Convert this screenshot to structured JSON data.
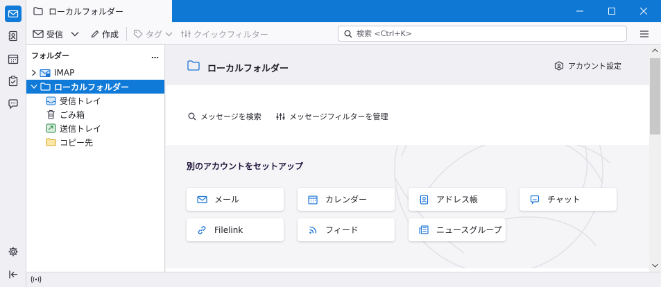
{
  "colors": {
    "accent": "#0f7ad8",
    "titlebar": "#0f78d4",
    "icon_blue": "#1a74d6",
    "folder_yellow": "#f2c94c"
  },
  "spaces": [
    {
      "name": "mail-icon",
      "active": true
    },
    {
      "name": "address-book-icon",
      "active": false
    },
    {
      "name": "calendar-icon",
      "active": false
    },
    {
      "name": "tasks-icon",
      "active": false
    },
    {
      "name": "chat-icon",
      "active": false
    }
  ],
  "tab": {
    "title": "ローカルフォルダー"
  },
  "toolbar": {
    "get_messages": "受信",
    "write": "作成",
    "tag": "タグ",
    "quick_filter": "クイックフィルター",
    "search_placeholder": "検索 <Ctrl+K>"
  },
  "folder_pane": {
    "header": "フォルダー",
    "menu": "…",
    "items": [
      {
        "label": "IMAP",
        "icon": "imap-account-icon"
      },
      {
        "label": "ローカルフォルダー",
        "icon": "folder-icon",
        "selected": true
      },
      {
        "label": "受信トレイ",
        "icon": "inbox-icon"
      },
      {
        "label": "ごみ箱",
        "icon": "trash-icon"
      },
      {
        "label": "送信トレイ",
        "icon": "outbox-icon"
      },
      {
        "label": "コピー先",
        "icon": "folder-icon"
      }
    ]
  },
  "content": {
    "title": "ローカルフォルダー",
    "account_settings": "アカウント設定",
    "search_messages": "メッセージを検索",
    "manage_filters": "メッセージフィルターを管理",
    "setup_title": "別のアカウントをセットアップ",
    "setup_cards": [
      {
        "label": "メール",
        "icon": "mail-icon"
      },
      {
        "label": "カレンダー",
        "icon": "calendar-icon"
      },
      {
        "label": "アドレス帳",
        "icon": "address-book-icon"
      },
      {
        "label": "チャット",
        "icon": "chat-icon"
      },
      {
        "label": "Filelink",
        "icon": "link-icon"
      },
      {
        "label": "フィード",
        "icon": "rss-icon"
      },
      {
        "label": "ニュースグループ",
        "icon": "newsgroup-icon"
      }
    ]
  }
}
